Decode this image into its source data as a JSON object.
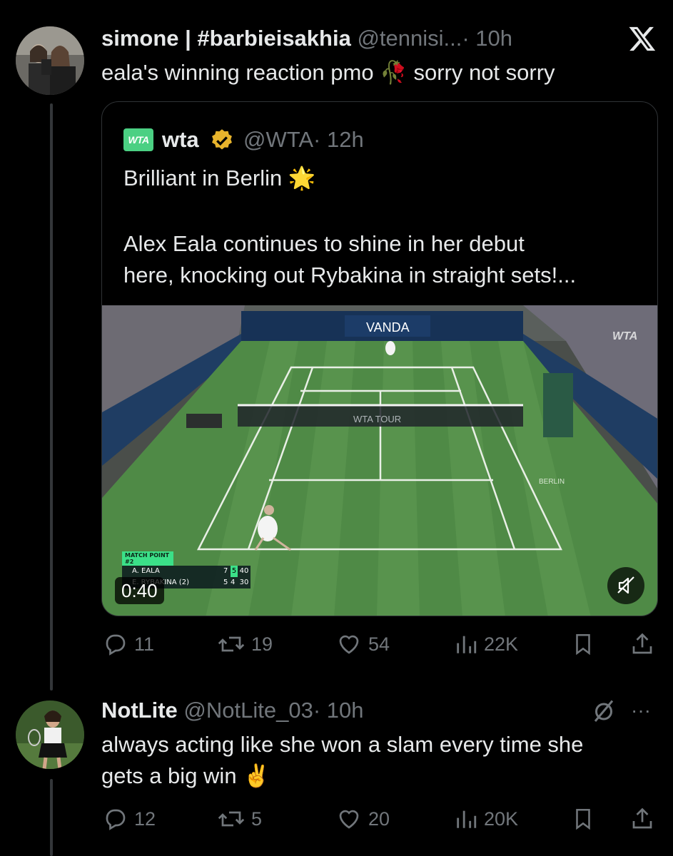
{
  "tweet1": {
    "display_name": "simone | #barbieisakhia",
    "handle": "@tennisi...",
    "time": "· 10h",
    "text": "eala's winning reaction pmo",
    "emoji": "🥀",
    "text_after": "sorry not sorry",
    "quote": {
      "display_name": "wta",
      "handle": "@WTA",
      "time": "· 12h",
      "line1": "Brilliant in Berlin",
      "line1_emoji": "🌟",
      "line2": "Alex Eala continues to shine in her debut",
      "line3": "here, knocking out Rybakina in straight sets!...",
      "logo_text": "WTA",
      "video": {
        "duration": "0:40",
        "watermark": "WTA",
        "sponsor_main": "VANDA",
        "net_brand": "WTA TOUR",
        "court_label_right": "BERLIN",
        "score": {
          "title": "MATCH POINT #2",
          "players": [
            {
              "name": "A. EALA",
              "sets": [
                "7",
                "5"
              ],
              "points": "40"
            },
            {
              "name": "E. RYBAKINA (2)",
              "sets": [
                "5",
                "4"
              ],
              "points": "30"
            }
          ]
        }
      }
    },
    "actions": {
      "replies": "11",
      "reposts": "19",
      "likes": "54",
      "views": "22K"
    }
  },
  "tweet2": {
    "display_name": "NotLite",
    "handle": "@NotLite_03",
    "time": "· 10h",
    "more": "···",
    "line1": "always acting like she won a slam every time she",
    "line2": "gets a big win",
    "emoji": "✌️",
    "actions": {
      "replies": "12",
      "reposts": "5",
      "likes": "20",
      "views": "20K"
    }
  },
  "colors": {
    "accent_green": "#4bd083",
    "text": "#e7e9ea",
    "muted": "#71767b",
    "background": "#000000"
  }
}
